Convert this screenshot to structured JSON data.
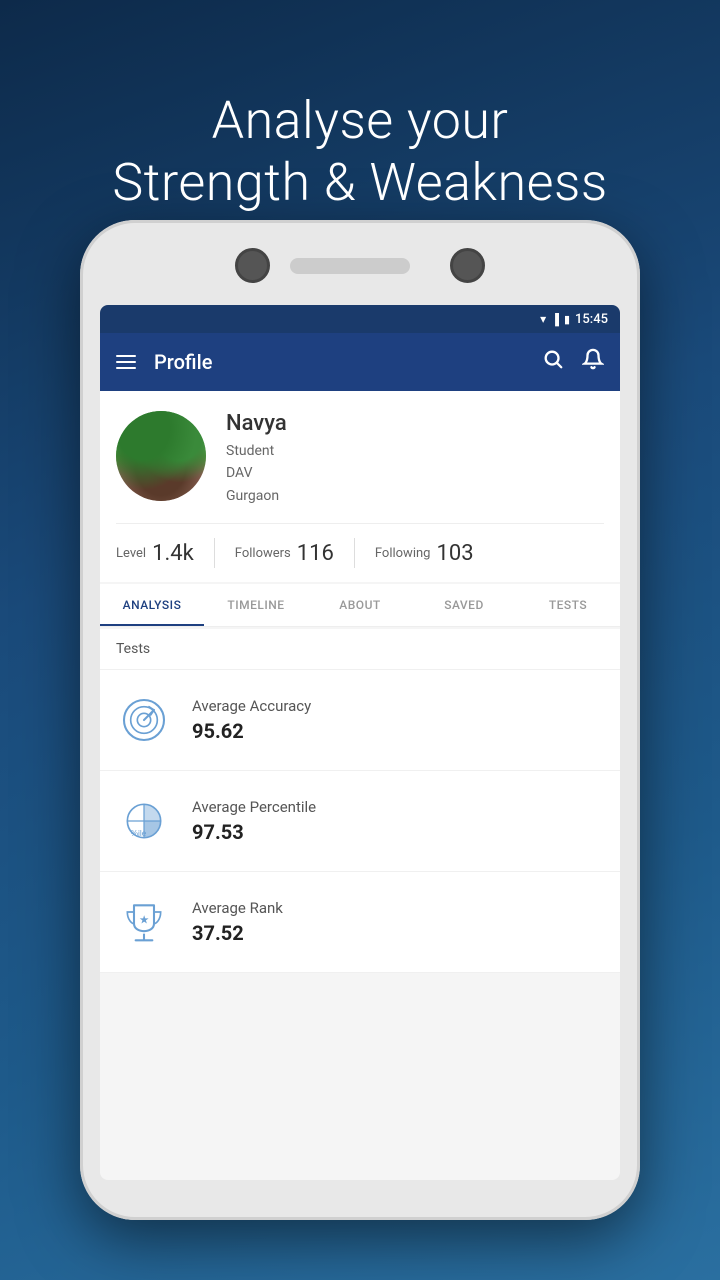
{
  "background_gradient": {
    "from": "#0d2a4a",
    "to": "#2a6fa0"
  },
  "tagline": {
    "line1": "Analyse your",
    "line2": "Strength & Weakness"
  },
  "status_bar": {
    "time": "15:45"
  },
  "app_bar": {
    "title": "Profile",
    "menu_icon": "menu-icon",
    "search_icon": "search-icon",
    "notification_icon": "bell-icon"
  },
  "profile": {
    "name": "Navya",
    "role": "Student",
    "institution": "DAV",
    "location": "Gurgaon",
    "level_label": "Level",
    "level_value": "1.4k",
    "followers_label": "Followers",
    "followers_value": "116",
    "following_label": "Following",
    "following_value": "103"
  },
  "tabs": [
    {
      "id": "analysis",
      "label": "ANALYSIS",
      "active": true
    },
    {
      "id": "timeline",
      "label": "TIMELINE",
      "active": false
    },
    {
      "id": "about",
      "label": "ABOUT",
      "active": false
    },
    {
      "id": "saved",
      "label": "SAVED",
      "active": false
    },
    {
      "id": "tests",
      "label": "TESTS",
      "active": false
    }
  ],
  "analysis": {
    "section_title": "Tests",
    "stats": [
      {
        "id": "accuracy",
        "name": "Average Accuracy",
        "value": "95.62",
        "icon": "target-icon"
      },
      {
        "id": "percentile",
        "name": "Average Percentile",
        "value": "97.53",
        "icon": "percentile-icon"
      },
      {
        "id": "rank",
        "name": "Average Rank",
        "value": "37.52",
        "icon": "trophy-icon"
      }
    ]
  }
}
